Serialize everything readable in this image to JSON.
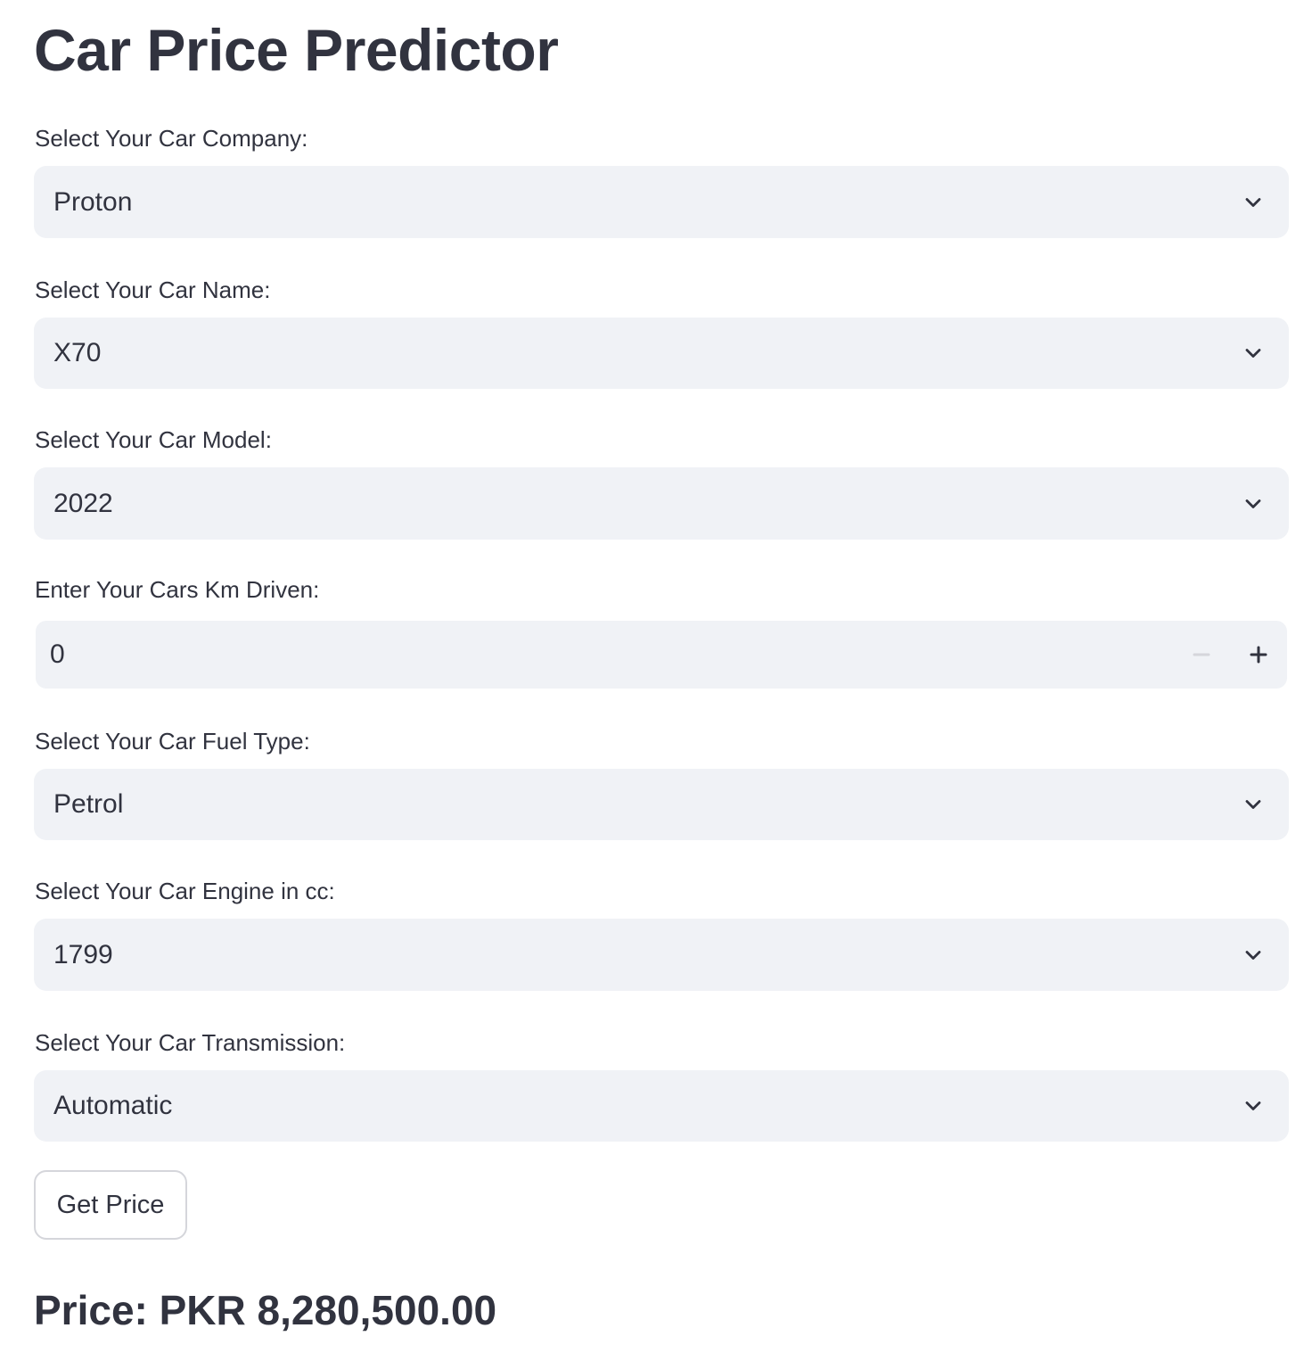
{
  "title": "Car Price Predictor",
  "fields": {
    "company": {
      "label": "Select Your Car Company:",
      "value": "Proton"
    },
    "name": {
      "label": "Select Your Car Name:",
      "value": "X70"
    },
    "model": {
      "label": "Select Your Car Model:",
      "value": "2022"
    },
    "km": {
      "label": "Enter Your Cars Km Driven:",
      "value": "0"
    },
    "fuel": {
      "label": "Select Your Car Fuel Type:",
      "value": "Petrol"
    },
    "engine": {
      "label": "Select Your Car Engine in cc:",
      "value": "1799"
    },
    "transmission": {
      "label": "Select Your Car Transmission:",
      "value": "Automatic"
    }
  },
  "button": {
    "label": "Get Price"
  },
  "result": {
    "text": "Price: PKR 8,280,500.00"
  },
  "icons": {
    "dropdown": "chevron-down-icon",
    "decrement": "minus-icon",
    "increment": "plus-icon"
  },
  "colors": {
    "text": "#31333f",
    "input_background": "#f0f2f6",
    "button_border": "#d5d6db",
    "disabled_icon": "#d5d6db"
  }
}
